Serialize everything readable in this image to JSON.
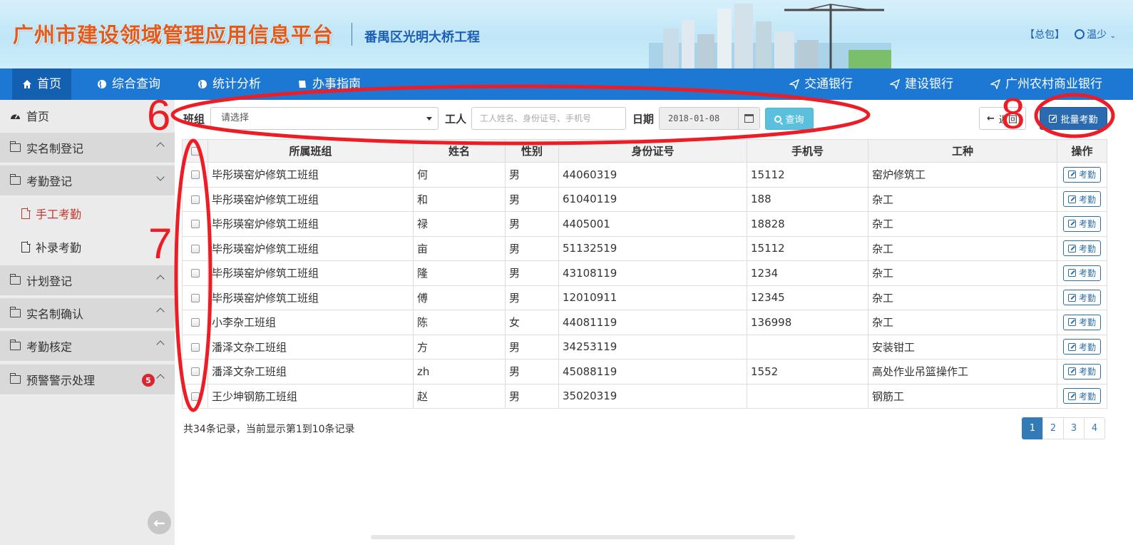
{
  "header": {
    "title": "广州市建设领域管理应用信息平台",
    "project": "番禺区光明大桥工程",
    "link_package": "【总包】",
    "user_name": "温少"
  },
  "nav": {
    "items": [
      {
        "label": "首页",
        "icon": "home-icon"
      },
      {
        "label": "综合查询",
        "icon": "globe-icon"
      },
      {
        "label": "统计分析",
        "icon": "globe-icon"
      },
      {
        "label": "办事指南",
        "icon": "book-icon"
      }
    ],
    "banks": [
      "交通银行",
      "建设银行",
      "广州农村商业银行"
    ]
  },
  "sidebar": {
    "home": "首页",
    "groups": [
      {
        "label": "实名制登记",
        "expanded": false
      },
      {
        "label": "考勤登记",
        "expanded": true
      },
      {
        "label": "计划登记",
        "expanded": false
      },
      {
        "label": "实名制确认",
        "expanded": false
      },
      {
        "label": "考勤核定",
        "expanded": false
      },
      {
        "label": "预警警示处理",
        "expanded": false,
        "badge": "5"
      }
    ],
    "sub_items": [
      "手工考勤",
      "补录考勤"
    ]
  },
  "filter": {
    "team_label": "班组",
    "team_value": "请选择",
    "worker_label": "工人",
    "worker_placeholder": "工人姓名、身份证号、手机号",
    "date_label": "日期",
    "date_value": "2018-01-08",
    "search_label": "查询",
    "back_label": "返回",
    "batch_label": "批量考勤"
  },
  "table": {
    "columns": [
      "所属班组",
      "姓名",
      "性别",
      "身份证号",
      "手机号",
      "工种",
      "操作"
    ],
    "action_label": "考勤",
    "rows": [
      {
        "team": "毕彤瑛窑炉修筑工班组",
        "name": "何",
        "gender": "男",
        "id": "44060319",
        "phone": "15112",
        "trade": "窑炉修筑工"
      },
      {
        "team": "毕彤瑛窑炉修筑工班组",
        "name": "和",
        "gender": "男",
        "id": "61040119",
        "phone": "188",
        "trade": "杂工"
      },
      {
        "team": "毕彤瑛窑炉修筑工班组",
        "name": "禄",
        "gender": "男",
        "id": "4405001",
        "phone": "18828",
        "trade": "杂工"
      },
      {
        "team": "毕彤瑛窑炉修筑工班组",
        "name": "亩",
        "gender": "男",
        "id": "51132519",
        "phone": "15112",
        "trade": "杂工"
      },
      {
        "team": "毕彤瑛窑炉修筑工班组",
        "name": "隆",
        "gender": "男",
        "id": "43108119",
        "phone": "1234",
        "trade": "杂工"
      },
      {
        "team": "毕彤瑛窑炉修筑工班组",
        "name": "傅",
        "gender": "男",
        "id": "12010911",
        "phone": "12345",
        "trade": "杂工"
      },
      {
        "team": "小李杂工班组",
        "name": "陈",
        "gender": "女",
        "id": "44081119",
        "phone": "136998",
        "trade": "杂工"
      },
      {
        "team": "潘泽文杂工班组",
        "name": "方",
        "gender": "男",
        "id": "34253119",
        "phone": "",
        "trade": "安装钳工"
      },
      {
        "team": "潘泽文杂工班组",
        "name": "zh",
        "gender": "男",
        "id": "45088119",
        "phone": "1552",
        "trade": "高处作业吊篮操作工"
      },
      {
        "team": "王少坤钢筋工班组",
        "name": "赵",
        "gender": "男",
        "id": "35020319",
        "phone": "",
        "trade": "钢筋工"
      }
    ]
  },
  "footer": {
    "summary": "共34条记录，当前显示第1到10条记录",
    "pages": [
      "1",
      "2",
      "3",
      "4"
    ],
    "current_page": "1"
  },
  "annotations": {
    "labels": [
      "6",
      "7",
      "8"
    ],
    "color": "#ee1c25"
  },
  "colors": {
    "nav_bg": "#1c78d3",
    "title": "#e35a1d",
    "project": "#1e5fb6",
    "active_sub": "#c1392b",
    "badge": "#d9262f",
    "search_btn": "#5bc0de",
    "batch_btn": "#2a6ab0"
  }
}
